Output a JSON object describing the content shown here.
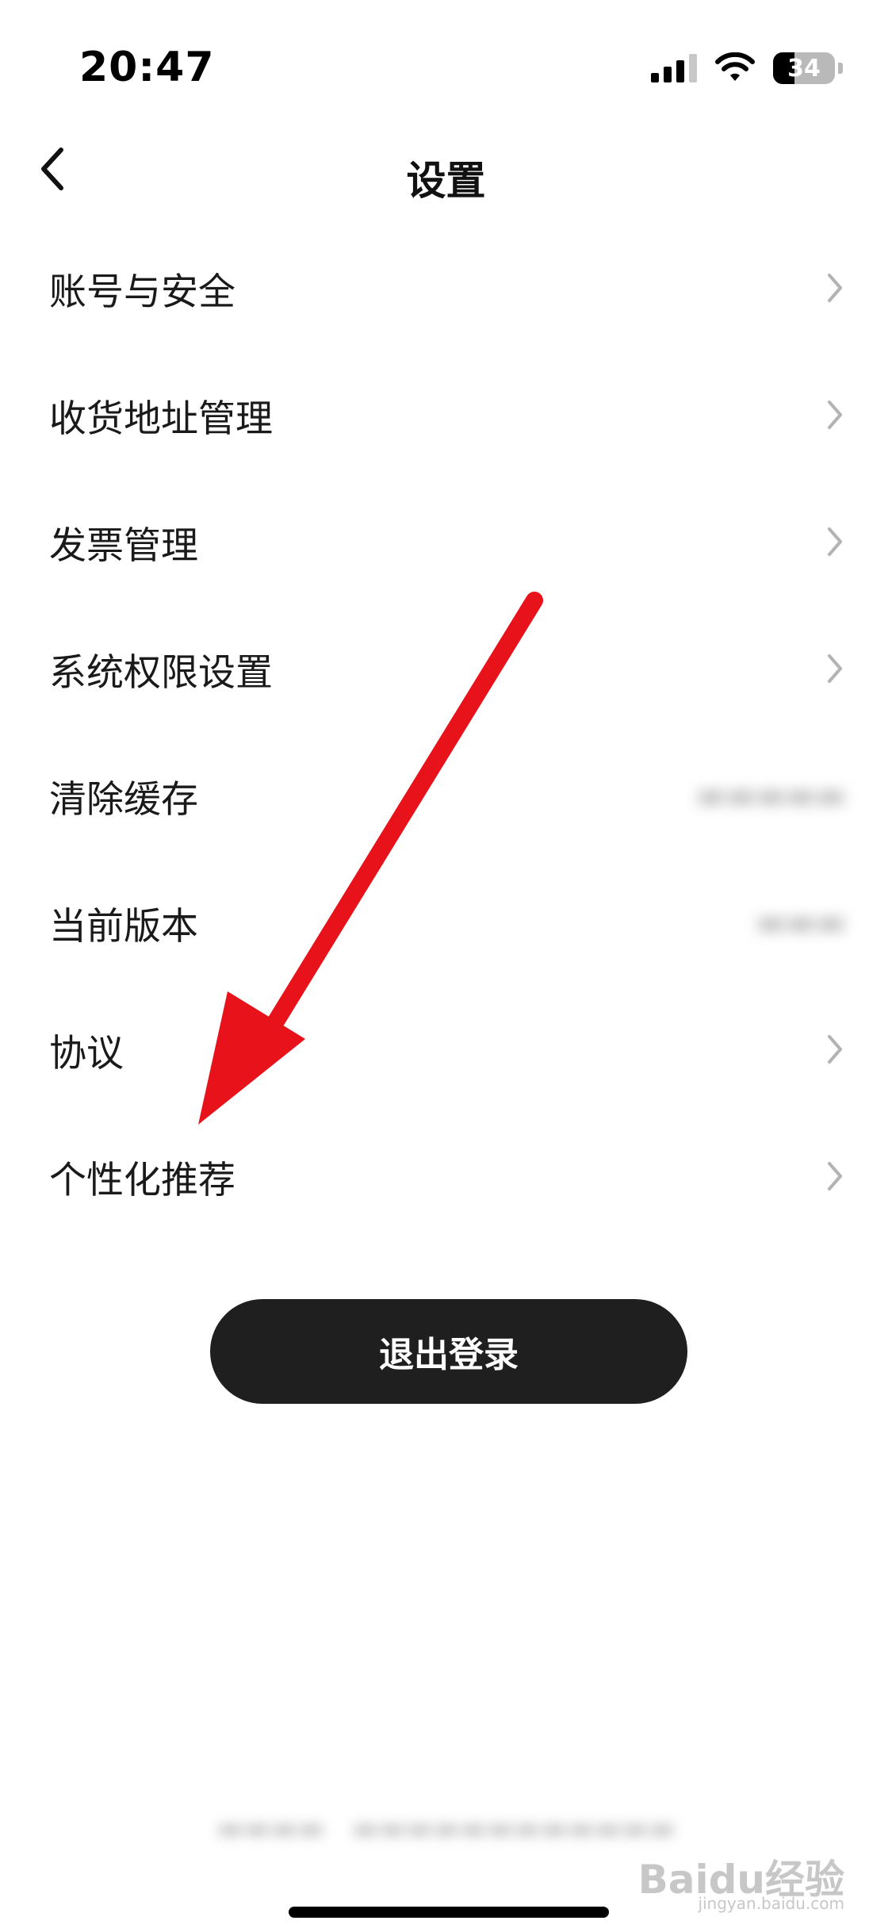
{
  "status_bar": {
    "time": "20:47",
    "battery": "34",
    "battery_level": 0.34
  },
  "nav": {
    "title": "设置"
  },
  "settings": {
    "items": [
      {
        "label": "账号与安全"
      },
      {
        "label": "收货地址管理"
      },
      {
        "label": "发票管理"
      },
      {
        "label": "系统权限设置"
      },
      {
        "label": "清除缓存"
      },
      {
        "label": "当前版本"
      },
      {
        "label": "协议"
      },
      {
        "label": "个性化推荐"
      }
    ]
  },
  "logout": {
    "label": "退出登录"
  },
  "watermark": {
    "logo": "Baidu经验",
    "url": "jingyan.baidu.com"
  },
  "colors": {
    "annotation_arrow": "#e8121a",
    "logout_background": "#1f1f1f"
  }
}
